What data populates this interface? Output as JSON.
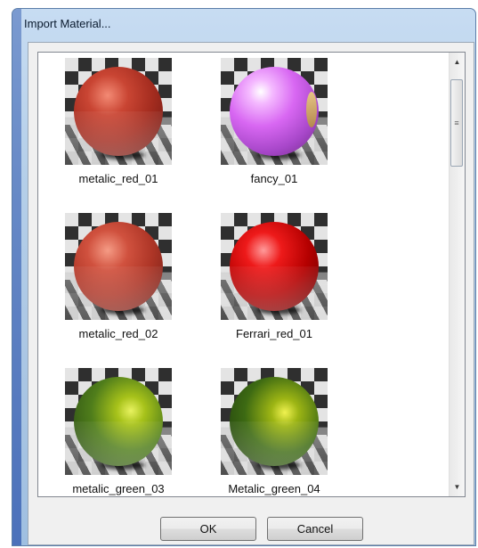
{
  "window": {
    "title": "Import Material..."
  },
  "materials": [
    {
      "label": "metalic_red_01",
      "style": "red1"
    },
    {
      "label": "fancy_01",
      "style": "fancy"
    },
    {
      "label": "metalic_red_02",
      "style": "red2"
    },
    {
      "label": "Ferrari_red_01",
      "style": "ferrari"
    },
    {
      "label": "metalic_green_03",
      "style": "green3"
    },
    {
      "label": "Metalic_green_04",
      "style": "green4"
    }
  ],
  "scrollbar": {
    "up_icon": "triangle-up",
    "down_icon": "triangle-down",
    "grip_icon": "grip-lines"
  },
  "buttons": {
    "ok_label": "OK",
    "cancel_label": "Cancel"
  }
}
